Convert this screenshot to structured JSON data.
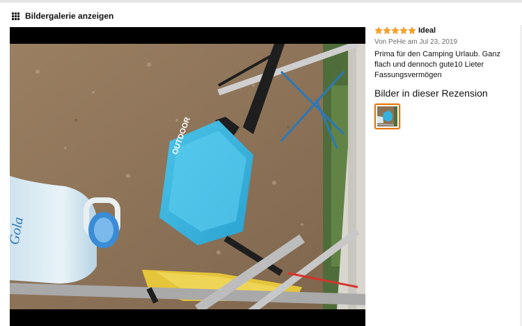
{
  "gallery": {
    "title": "Bildergalerie anzeigen",
    "icon": "grid-icon"
  },
  "photo": {
    "label_bottle": "Gola",
    "label_basin": "OUTDOOR"
  },
  "review": {
    "rating": 5,
    "rating_max": 5,
    "star_color": "#ffa41c",
    "title": "Ideal",
    "meta": "Von PeHe am Jul 23, 2019",
    "body": "Prima für den Camping Urlaub. Ganz flach und dennoch gute10 Lieter Fassungsvermögen",
    "images_heading": "Bilder in dieser Rezension"
  },
  "colors": {
    "accent": "#e77600",
    "viewer_bg": "#000000"
  }
}
